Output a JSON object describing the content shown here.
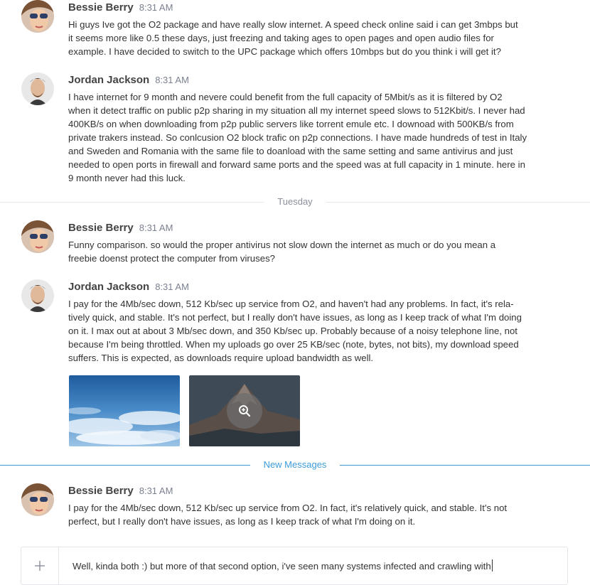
{
  "messages": [
    {
      "author": "Bessie Berry",
      "time": "8:31 AM",
      "avatar": "female-avatar",
      "lines": [
        "Hi guys Ive got the O2 package and have really slow internet. A speed check online said i can get 3mbps but",
        "it seems more like 0.5 these days, just freezing and taking ages to open pages and open audio files for",
        "example. I have decided to switch to the UPC package which offers 10mbps but do you think i will get it?"
      ]
    },
    {
      "author": "Jordan Jackson",
      "time": "8:31 AM",
      "avatar": "male-avatar",
      "lines": [
        "I have internet for 9 month and nevere could benefit from the full capacity of 5Mbit/s as it is filtered by O2",
        "when it detect traffic on public p2p sharing in my situation all my internet speed slows to 512Kbit/s. I never had",
        "400KB/s on when downloading from p2p public servers like torrent emule etc. I downoad with 500KB/s from",
        "private trakers instead. So conlcusion O2 block trafic on p2p connections. I have made hundreds of test in Italy",
        "and Sweden and Romania with the same file to doanload with the same setting and same antivirus and just",
        "needed to open ports in firewall and forward same ports and the speed was at full capacity in 1 minute. here in",
        "9 month never had this luck."
      ]
    },
    {
      "author": "Bessie Berry",
      "time": "8:31 AM",
      "avatar": "female-avatar",
      "lines": [
        "Funny comparison. so would the proper antivirus not slow down the internet as much or do you mean a",
        "freebie doenst protect the computer from viruses?"
      ]
    },
    {
      "author": "Jordan Jackson",
      "time": "8:31 AM",
      "avatar": "male-avatar",
      "lines": [
        "I pay for the 4Mb/sec down, 512 Kb/sec up service from O2, and haven't had any problems. In fact, it's rela-",
        "tively quick, and stable. It's not perfect, but I really don't have issues, as long as I keep track of what I'm doing",
        "on it. I max out at about 3 Mb/sec down, and 350 Kb/sec up. Probably because of a noisy telephone line, not",
        "because I'm being throttled. When my uploads go over 25 KB/sec (note, bytes, not bits), my download speed",
        "suffers. This is expected, as downloads require upload bandwidth as well."
      ]
    },
    {
      "author": "Bessie Berry",
      "time": "8:31 AM",
      "avatar": "female-avatar",
      "lines": [
        "I pay for the 4Mb/sec down, 512 Kb/sec up service from O2. In fact, it's relatively quick, and stable. It's not",
        "perfect, but I really don't have issues, as long as I keep track of what I'm doing on it."
      ]
    }
  ],
  "dividers": {
    "day": "Tuesday",
    "new": "New Messages"
  },
  "attachments": [
    {
      "kind": "sky-image"
    },
    {
      "kind": "mountain-image",
      "overlay_icon": "zoom-in-icon"
    }
  ],
  "composer": {
    "add_icon": "plus-icon",
    "value": "Well, kinda both :) but more of that second option, i've seen many systems infected and crawling with"
  },
  "colors": {
    "divider_line": "#e6e8eb",
    "new_divider": "#3d9bd9",
    "day_label": "#8a8f99",
    "timestamp": "#7b8190"
  }
}
